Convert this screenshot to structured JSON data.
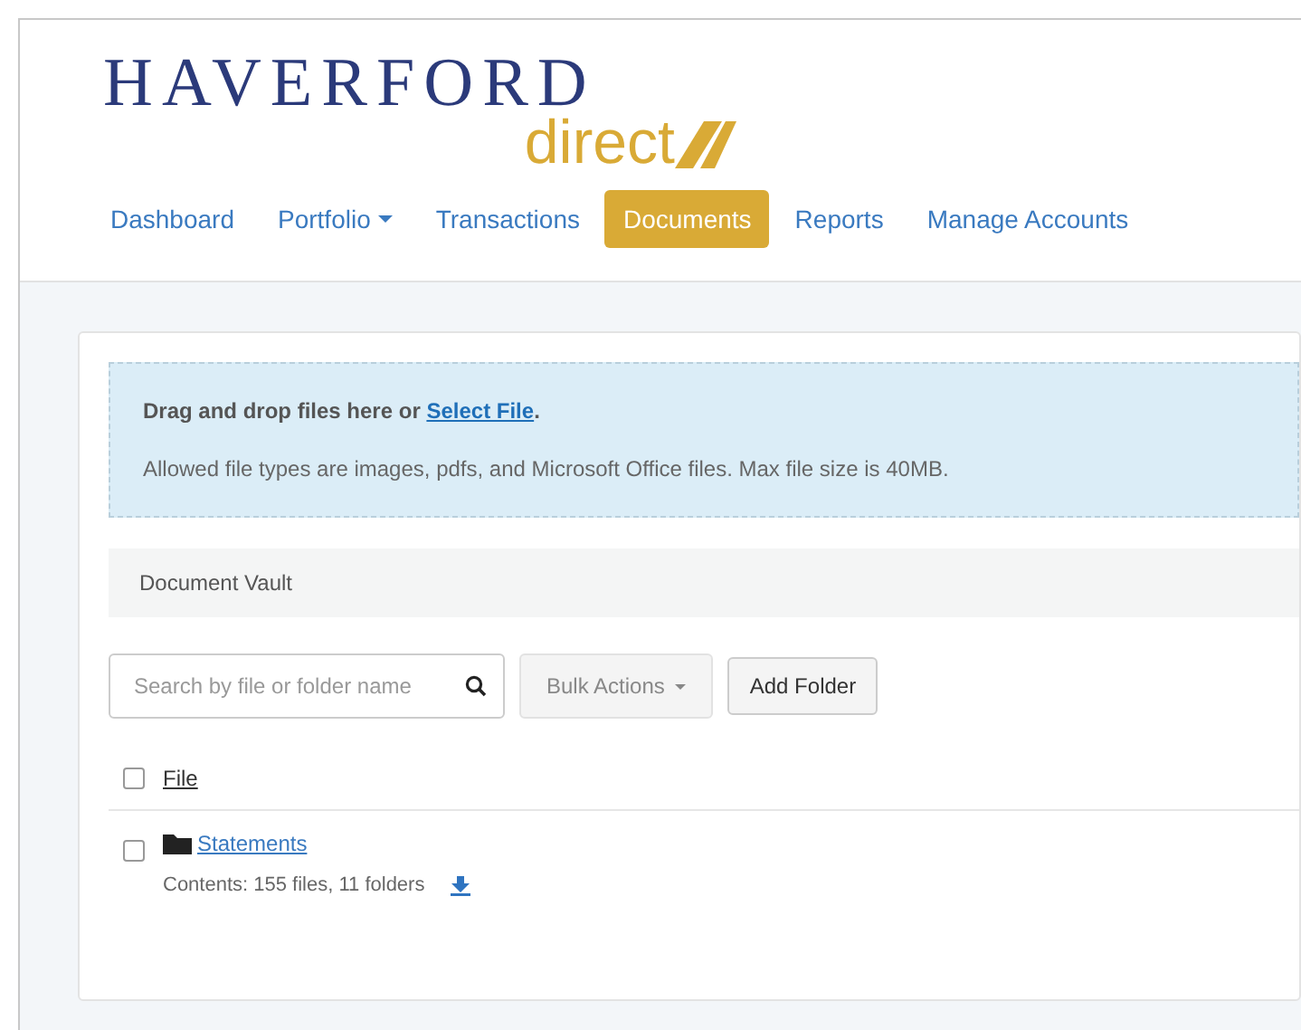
{
  "logo": {
    "wordmark": "HAVERFORD",
    "subtitle": "direct"
  },
  "nav": [
    {
      "label": "Dashboard",
      "selected": false,
      "dropdown": false
    },
    {
      "label": "Portfolio",
      "selected": false,
      "dropdown": true
    },
    {
      "label": "Transactions",
      "selected": false,
      "dropdown": false
    },
    {
      "label": "Documents",
      "selected": true,
      "dropdown": false
    },
    {
      "label": "Reports",
      "selected": false,
      "dropdown": false
    },
    {
      "label": "Manage Accounts",
      "selected": false,
      "dropdown": false
    }
  ],
  "dropzone": {
    "prompt": "Drag and drop files here or ",
    "link": "Select File",
    "prompt_end": ".",
    "note": "Allowed file types are images, pdfs, and Microsoft Office files. Max file size is 40MB."
  },
  "vault": {
    "title": "Document Vault"
  },
  "toolbar": {
    "search": {
      "placeholder": "Search by file or folder name"
    },
    "bulk_actions": "Bulk Actions",
    "add_folder": "Add Folder"
  },
  "table": {
    "header": {
      "label": "File",
      "checked": false
    },
    "rows": [
      {
        "name": "Statements",
        "contents": "Contents: 155 files, 11 folders",
        "checked": false
      }
    ]
  }
}
